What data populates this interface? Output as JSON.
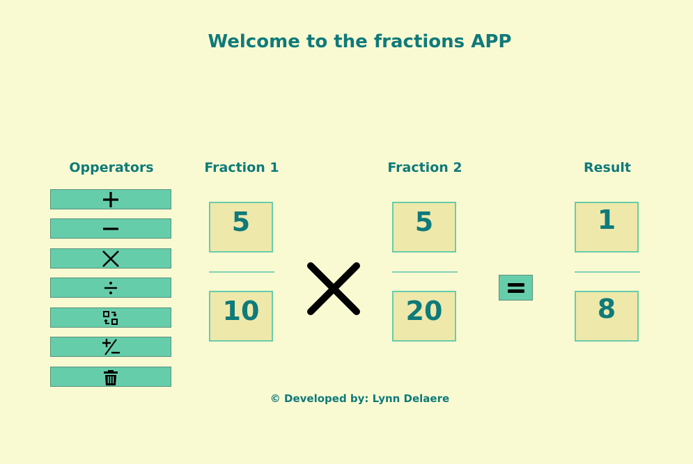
{
  "header": {
    "title": "Welcome to the fractions APP"
  },
  "columns": {
    "operators": "Opperators",
    "fraction1": "Fraction 1",
    "fraction2": "Fraction 2",
    "result": "Result"
  },
  "operators": [
    {
      "icon": "plus-icon"
    },
    {
      "icon": "minus-icon"
    },
    {
      "icon": "multiply-icon"
    },
    {
      "icon": "divide-icon"
    },
    {
      "icon": "swap-icon"
    },
    {
      "icon": "plus-minus-icon"
    },
    {
      "icon": "trash-icon"
    }
  ],
  "fraction1": {
    "numerator": "5",
    "denominator": "10"
  },
  "fraction2": {
    "numerator": "5",
    "denominator": "20"
  },
  "result": {
    "numerator": "1",
    "denominator": "8"
  },
  "selected_operator": "multiply-icon",
  "equals_icon": "equals-icon",
  "footer": {
    "text": "© Developed by: Lynn Delaere"
  },
  "colors": {
    "background": "#fafad2",
    "accent": "#66cdaa",
    "text": "#0f7a7a",
    "box": "#eee8aa"
  }
}
